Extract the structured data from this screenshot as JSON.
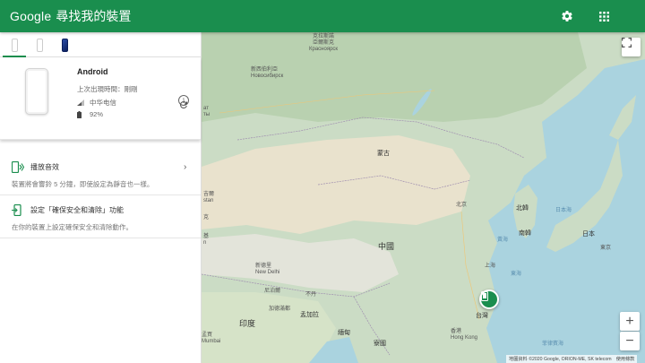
{
  "header": {
    "logo": "Google",
    "title": "尋找我的裝置",
    "settings_icon": "gear-icon",
    "apps_icon": "apps-grid-icon",
    "background": "#1a8e4e"
  },
  "device_tabs": [
    {
      "name": "device-1",
      "active": true
    },
    {
      "name": "device-2",
      "active": false
    },
    {
      "name": "device-3",
      "active": false
    }
  ],
  "device": {
    "name": "Android",
    "last_seen": "上次出現時間：剛剛",
    "carrier": "中华电信",
    "battery": "92%"
  },
  "actions": [
    {
      "title": "播放音效",
      "description": "裝置將會響鈴 5 分鐘，即使設定為靜音也一樣。",
      "icon": "play-sound-icon"
    },
    {
      "title": "設定「確保安全和清除」功能",
      "description": "在你的裝置上設定確保安全和清除動作。",
      "icon": "secure-erase-icon"
    }
  ],
  "map": {
    "labels": {
      "krasnoyarsk": "克拉斯諾\n亞爾斯克\nКрасноярск",
      "novosibirsk": "新西伯利亞\nНовосибирск",
      "almaty_top": "ат\nты",
      "mongolia": "蒙古",
      "beijing": "北京",
      "north_korea": "北韓",
      "south_korea": "南韓",
      "sea_of_japan": "日本海",
      "japan": "日本",
      "yellow_sea": "黃海",
      "east_sea": "東海",
      "china": "中國",
      "shanghai": "上海",
      "tokyo": "東京",
      "nepal": "尼泊爾",
      "kathmandu": "加德滿都",
      "new_delhi": "新德里\nNew Delhi",
      "bhutan": "不丹",
      "bangladesh": "孟加拉",
      "india": "印度",
      "myanmar": "緬甸",
      "laos": "寮國",
      "taiwan": "台灣",
      "hong_kong": "香港\nHong Kong",
      "mumbai": "孟買\nMumbai",
      "pakistan_left": "基\nn",
      "left_edge_1": "克",
      "left_edge_2": "吉爾\nstan",
      "philippine_sea": "菲律賓海"
    },
    "attribution": "地圖資料 ©2020 Google, ORION-ME, SK telecom　使用條款"
  }
}
